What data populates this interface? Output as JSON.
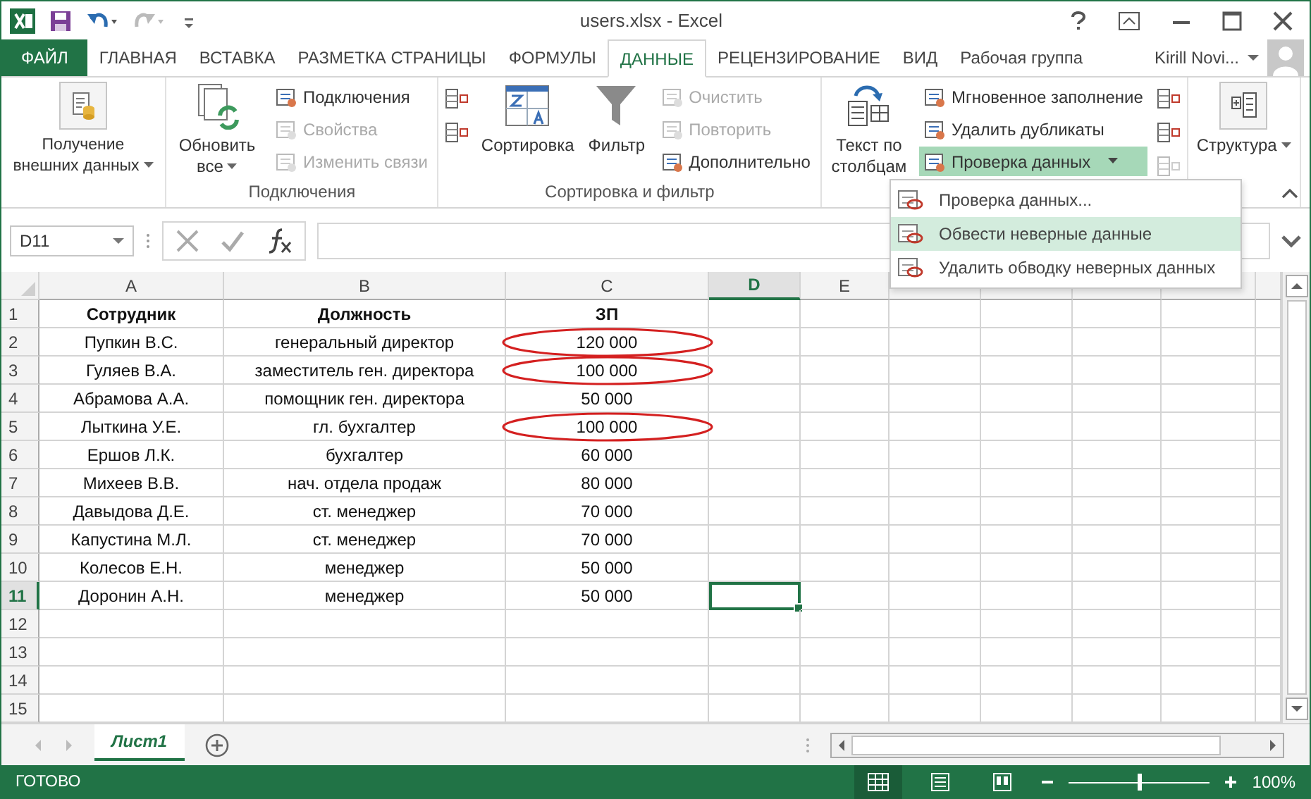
{
  "window": {
    "title": "users.xlsx - Excel"
  },
  "tabs": [
    {
      "label": "ФАЙЛ",
      "kind": "file",
      "selected": false
    },
    {
      "label": "ГЛАВНАЯ",
      "kind": "tab",
      "selected": false
    },
    {
      "label": "ВСТАВКА",
      "kind": "tab",
      "selected": false
    },
    {
      "label": "РАЗМЕТКА СТРАНИЦЫ",
      "kind": "tab",
      "selected": false
    },
    {
      "label": "ФОРМУЛЫ",
      "kind": "tab",
      "selected": false
    },
    {
      "label": "ДАННЫЕ",
      "kind": "tab",
      "selected": true
    },
    {
      "label": "РЕЦЕНЗИРОВАНИЕ",
      "kind": "tab",
      "selected": false
    },
    {
      "label": "ВИД",
      "kind": "tab",
      "selected": false
    },
    {
      "label": "Рабочая группа",
      "kind": "tab",
      "selected": false
    }
  ],
  "account": {
    "name": "Kirill Novi..."
  },
  "ribbon": {
    "groups": [
      {
        "columns": [
          {
            "kind": "large",
            "label": "Получение внешних данных",
            "dropdown": true
          }
        ]
      },
      {
        "label": "Подключения",
        "columns": [
          {
            "kind": "large",
            "label": "Обновить все",
            "dropdown": true
          },
          {
            "kind": "stack",
            "items": [
              {
                "label": "Подключения",
                "disabled": false
              },
              {
                "label": "Свойства",
                "disabled": true
              },
              {
                "label": "Изменить связи",
                "disabled": true
              }
            ]
          }
        ]
      },
      {
        "label": "Сортировка и фильтр",
        "columns": [
          {
            "kind": "icons",
            "items": [
              {
                "disabled": false
              },
              {
                "disabled": false
              }
            ]
          },
          {
            "kind": "large",
            "label": "Сортировка"
          },
          {
            "kind": "large",
            "label": "Фильтр"
          },
          {
            "kind": "stack",
            "items": [
              {
                "label": "Очистить",
                "disabled": true
              },
              {
                "label": "Повторить",
                "disabled": true
              },
              {
                "label": "Дополнительно",
                "disabled": false
              }
            ]
          }
        ]
      },
      {
        "columns": [
          {
            "kind": "large",
            "label": "Текст по столбцам"
          },
          {
            "kind": "stack",
            "items": [
              {
                "label": "Мгновенное заполнение",
                "disabled": false,
                "selected": false
              },
              {
                "label": "Удалить дубликаты",
                "disabled": false,
                "selected": false
              },
              {
                "label": "Проверка данных",
                "disabled": false,
                "selected": true,
                "dropdown": true
              }
            ]
          },
          {
            "kind": "icons",
            "items": [
              {
                "disabled": false
              },
              {
                "disabled": false
              },
              {
                "disabled": true
              }
            ]
          }
        ]
      },
      {
        "columns": [
          {
            "kind": "large",
            "label": "Структура",
            "dropdown": true
          }
        ]
      }
    ]
  },
  "menu": {
    "items": [
      {
        "label": "Проверка данных...",
        "selected": false
      },
      {
        "label": "Обвести неверные данные",
        "selected": true
      },
      {
        "label": "Удалить обводку неверных данных",
        "selected": false
      }
    ]
  },
  "formula_bar": {
    "name_box": "D11"
  },
  "sheet": {
    "columns": [
      {
        "label": "A",
        "selected": false
      },
      {
        "label": "B",
        "selected": false
      },
      {
        "label": "C",
        "selected": false
      },
      {
        "label": "D",
        "selected": true
      },
      {
        "label": "E",
        "selected": false
      }
    ],
    "rows": [
      {
        "number": "1",
        "header": true,
        "invalid": false,
        "selected": false,
        "cells": [
          "Сотрудник",
          "Должность",
          "ЗП"
        ]
      },
      {
        "number": "2",
        "header": false,
        "invalid": true,
        "selected": false,
        "cells": [
          "Пупкин В.С.",
          "генеральный директор",
          "120 000"
        ]
      },
      {
        "number": "3",
        "header": false,
        "invalid": true,
        "selected": false,
        "cells": [
          "Гуляев В.А.",
          "заместитель ген. директора",
          "100 000"
        ]
      },
      {
        "number": "4",
        "header": false,
        "invalid": false,
        "selected": false,
        "cells": [
          "Абрамова А.А.",
          "помощник ген. директора",
          "50 000"
        ]
      },
      {
        "number": "5",
        "header": false,
        "invalid": true,
        "selected": false,
        "cells": [
          "Лыткина У.Е.",
          "гл. бухгалтер",
          "100 000"
        ]
      },
      {
        "number": "6",
        "header": false,
        "invalid": false,
        "selected": false,
        "cells": [
          "Ершов Л.К.",
          "бухгалтер",
          "60 000"
        ]
      },
      {
        "number": "7",
        "header": false,
        "invalid": false,
        "selected": false,
        "cells": [
          "Михеев В.В.",
          "нач. отдела продаж",
          "80 000"
        ]
      },
      {
        "number": "8",
        "header": false,
        "invalid": false,
        "selected": false,
        "cells": [
          "Давыдова Д.Е.",
          "ст. менеджер",
          "70 000"
        ]
      },
      {
        "number": "9",
        "header": false,
        "invalid": false,
        "selected": false,
        "cells": [
          "Капустина М.Л.",
          "ст. менеджер",
          "70 000"
        ]
      },
      {
        "number": "10",
        "header": false,
        "invalid": false,
        "selected": false,
        "cells": [
          "Колесов Е.Н.",
          "менеджер",
          "50 000"
        ]
      },
      {
        "number": "11",
        "header": false,
        "invalid": false,
        "selected": true,
        "cells": [
          "Доронин А.Н.",
          "менеджер",
          "50 000"
        ]
      },
      {
        "number": "12",
        "selected": false,
        "cells": []
      },
      {
        "number": "13",
        "selected": false,
        "cells": []
      },
      {
        "number": "14",
        "selected": false,
        "cells": []
      },
      {
        "number": "15",
        "selected": false,
        "cells": []
      }
    ]
  },
  "sheet_tabs": [
    {
      "label": "Лист1",
      "selected": true
    }
  ],
  "status_bar": {
    "text": "ГОТОВО",
    "views": [
      {
        "selected": true
      },
      {
        "selected": false
      },
      {
        "selected": false
      }
    ],
    "zoom": {
      "level": 0.5,
      "reading": "100%"
    }
  }
}
